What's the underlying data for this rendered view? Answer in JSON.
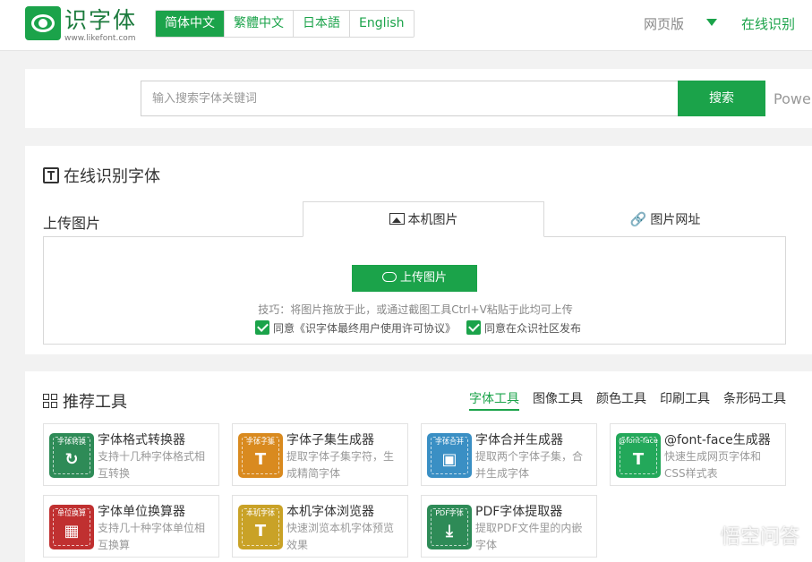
{
  "header": {
    "logo_text": "识字体",
    "logo_url": "www.likefont.com",
    "languages": [
      "简体中文",
      "繁體中文",
      "日本語",
      "English"
    ],
    "web_version": "网页版",
    "online_recognize": "在线识别"
  },
  "search": {
    "placeholder": "输入搜索字体关键词",
    "button": "搜索",
    "powered": "Powe"
  },
  "recognize": {
    "title": "在线识别字体",
    "upload_label": "上传图片",
    "tabs": [
      "本机图片",
      "图片网址"
    ],
    "upload_button": "上传图片",
    "tip": "技巧：将图片拖放于此，或通过截图工具Ctrl+V粘贴于此均可上传",
    "agree_license": "同意《识字体最终用户使用许可协议》",
    "agree_publish": "同意在众识社区发布"
  },
  "tools": {
    "title": "推荐工具",
    "categories": [
      "字体工具",
      "图像工具",
      "颜色工具",
      "印刷工具",
      "条形码工具"
    ],
    "items": [
      {
        "name": "字体格式转换器",
        "desc": "支持十几种字体格式相互转换",
        "icon_caption": "字体转换",
        "glyph": "↻",
        "color": "#2e8b57"
      },
      {
        "name": "字体子集生成器",
        "desc": "提取字体子集字符，生成精简字体",
        "icon_caption": "字体子集",
        "glyph": "T",
        "color": "#d98a1f"
      },
      {
        "name": "字体合并生成器",
        "desc": "提取两个字体子集，合并生成字体",
        "icon_caption": "字体合并",
        "glyph": "▣",
        "color": "#3a8fc4"
      },
      {
        "name": "@font-face生成器",
        "desc": "快速生成网页字体和CSS样式表",
        "icon_caption": "@font-face",
        "glyph": "T",
        "color": "#23a85a"
      },
      {
        "name": "字体单位换算器",
        "desc": "支持几十种字体单位相互换算",
        "icon_caption": "单位换算",
        "glyph": "▦",
        "color": "#c03030"
      },
      {
        "name": "本机字体浏览器",
        "desc": "快速浏览本机字体预览效果",
        "icon_caption": "本机字体",
        "glyph": "T",
        "color": "#c9a227"
      },
      {
        "name": "PDF字体提取器",
        "desc": "提取PDF文件里的内嵌字体",
        "icon_caption": "PDF字体",
        "glyph": "⤓",
        "color": "#2e8b57"
      }
    ]
  },
  "watermark": "悟空问答"
}
